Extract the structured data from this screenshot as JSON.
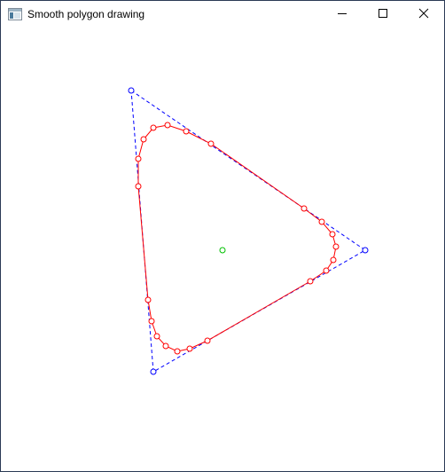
{
  "window": {
    "title": "Smooth polygon drawing"
  },
  "colors": {
    "control_polygon": "#0000ff",
    "smooth_curve": "#ff0000",
    "center_point": "#00c000"
  }
}
